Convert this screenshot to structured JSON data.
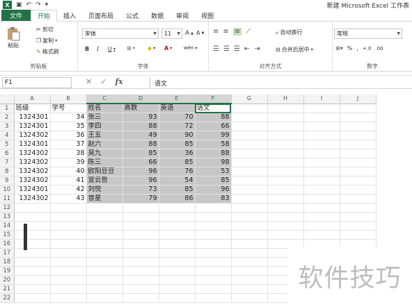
{
  "window": {
    "title": "新建 Microsoft Excel 工作表"
  },
  "icons": {
    "logo": "excel-logo-icon",
    "save": "save-icon",
    "undo": "undo-icon",
    "redo": "redo-icon",
    "customize": "customize-qat-icon"
  },
  "tabs": [
    "文件",
    "开始",
    "插入",
    "页面布局",
    "公式",
    "数据",
    "审阅",
    "视图"
  ],
  "active_tab": "开始",
  "ribbon": {
    "clipboard": {
      "paste": "粘贴",
      "cut": "剪切",
      "copy": "复制",
      "format_painter": "格式刷",
      "label": "剪贴板"
    },
    "font": {
      "name": "宋体",
      "size": "11",
      "grow": "A",
      "shrink": "A",
      "bold": "B",
      "italic": "I",
      "underline": "U",
      "border": "⊞",
      "fill": "◆",
      "color": "A",
      "phonetic": "wén",
      "label": "字体"
    },
    "alignment": {
      "wrap": "自动换行",
      "merge": "合并后居中",
      "label": "对齐方式"
    },
    "number": {
      "format": "常规",
      "percent": "%",
      "comma": ",",
      "inc_decimal": "+.0",
      "dec_decimal": ".00",
      "label": "数字"
    }
  },
  "formula_bar": {
    "name_box": "F1",
    "cancel": "✕",
    "enter": "✓",
    "fx": "fx",
    "content": "语文"
  },
  "columns": [
    "A",
    "B",
    "C",
    "D",
    "E",
    "F",
    "G",
    "H",
    "I",
    "J"
  ],
  "rows": [
    [
      "班级",
      "学号",
      "姓名",
      "高数",
      "英语",
      "语文"
    ],
    [
      "1324301",
      "34",
      "张三",
      "93",
      "70",
      "88"
    ],
    [
      "1324301",
      "35",
      "李四",
      "88",
      "72",
      "66"
    ],
    [
      "1324302",
      "36",
      "王五",
      "49",
      "90",
      "99"
    ],
    [
      "1324301",
      "37",
      "赵六",
      "88",
      "85",
      "58"
    ],
    [
      "1324302",
      "38",
      "吴九",
      "85",
      "36",
      "88"
    ],
    [
      "1324302",
      "39",
      "陈三",
      "66",
      "85",
      "98"
    ],
    [
      "1324302",
      "40",
      "欧阳豆豆",
      "96",
      "76",
      "53"
    ],
    [
      "1324302",
      "41",
      "宣云哲",
      "96",
      "54",
      "85"
    ],
    [
      "1324301",
      "42",
      "刘悦",
      "73",
      "85",
      "96"
    ],
    [
      "1324302",
      "43",
      "曾星",
      "79",
      "86",
      "83"
    ]
  ],
  "row_numbers": [
    "1",
    "2",
    "3",
    "4",
    "5",
    "6",
    "7",
    "8",
    "9",
    "10",
    "11",
    "12",
    "13",
    "14",
    "15",
    "16",
    "17",
    "18",
    "19",
    "20",
    "21",
    "22"
  ],
  "watermark": "软件技巧",
  "colors": {
    "accent": "#217346",
    "selection": "#c7c7c7"
  }
}
